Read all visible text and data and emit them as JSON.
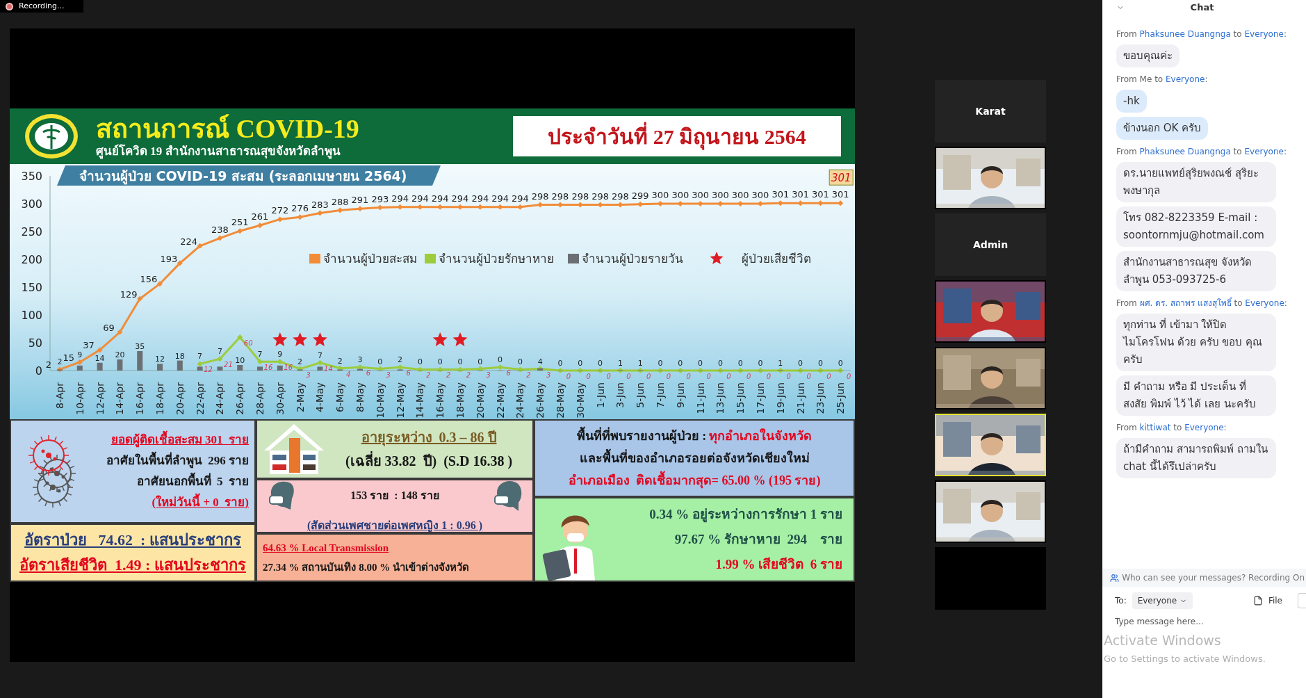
{
  "recording": {
    "label": "Recording..."
  },
  "slide": {
    "header": {
      "title": "สถานการณ์ COVID-19",
      "subtitle": "ศูนย์โควิด 19 สำนักงานสาธารณสุขจังหวัดลำพูน",
      "date": "ประจำวันที่ 27 มิถุนายน 2564"
    },
    "chart": {
      "chart_data": {
        "type": "line",
        "title": "จำนวนผู้ป่วย COVID-19 สะสม (ระลอกเมษายน 2564)",
        "categories": [
          "8-Apr",
          "10-Apr",
          "12-Apr",
          "14-Apr",
          "16-Apr",
          "18-Apr",
          "20-Apr",
          "22-Apr",
          "24-Apr",
          "26-Apr",
          "28-Apr",
          "30-Apr",
          "2-May",
          "4-May",
          "6-May",
          "8-May",
          "10-May",
          "12-May",
          "14-May",
          "16-May",
          "18-May",
          "20-May",
          "22-May",
          "24-May",
          "26-May",
          "28-May",
          "30-May",
          "1-Jun",
          "3-Jun",
          "5-Jun",
          "7-Jun",
          "9-Jun",
          "11-Jun",
          "13-Jun",
          "15-Jun",
          "17-Jun",
          "19-Jun",
          "21-Jun",
          "23-Jun",
          "25-Jun"
        ],
        "series": [
          {
            "name": "จำนวนผู้ป่วยสะสม",
            "color": "#f28c38",
            "marker": "diamond",
            "values": [
              2,
              15,
              37,
              69,
              129,
              156,
              193,
              224,
              238,
              251,
              261,
              272,
              276,
              283,
              288,
              291,
              293,
              294,
              294,
              294,
              294,
              294,
              294,
              294,
              298,
              298,
              298,
              298,
              298,
              299,
              300,
              300,
              300,
              300,
              300,
              300,
              301,
              301,
              301,
              301
            ],
            "value_labels": [
              "2",
              "15",
              "37",
              "69",
              "129",
              "156",
              "193",
              "224",
              "238",
              "251",
              "261",
              "272",
              "276",
              "283",
              "288",
              "291",
              "293",
              "294",
              "294",
              "294",
              "294",
              "294",
              "294",
              "294",
              "298",
              "298",
              "298",
              "298",
              "298",
              "299",
              "300",
              "300",
              "300",
              "300",
              "300",
              "300",
              "301",
              "301",
              "301",
              "301"
            ]
          },
          {
            "name": "จำนวนผู้ป่วยรักษาหาย",
            "color": "#9ccc3c",
            "marker": "diamond",
            "values": [
              null,
              null,
              null,
              null,
              null,
              null,
              null,
              12,
              21,
              60,
              16,
              16,
              3,
              14,
              4,
              6,
              3,
              6,
              2,
              2,
              2,
              3,
              6,
              2,
              3,
              0,
              0,
              0,
              0,
              0,
              0,
              0,
              0,
              0,
              0,
              0,
              0,
              0,
              0,
              0
            ],
            "value_labels": [
              null,
              null,
              null,
              null,
              null,
              null,
              null,
              "12",
              "21",
              "60",
              "16",
              "16",
              "3",
              "14",
              "4",
              "6",
              "3",
              "6",
              "2",
              "2",
              "2",
              "3",
              "6",
              "2",
              "3",
              "0",
              "0",
              "0",
              "0",
              "0",
              "0",
              "0",
              "0",
              "0",
              "0",
              "0",
              "0",
              "0",
              "0",
              "0"
            ]
          },
          {
            "name": "จำนวนผู้ป่วยรายวัน",
            "type": "bar",
            "color": "#6b6f73",
            "values": [
              2,
              9,
              14,
              20,
              35,
              12,
              18,
              7,
              7,
              10,
              7,
              9,
              2,
              7,
              2,
              3,
              0,
              2,
              0,
              0,
              0,
              0,
              0,
              0,
              4,
              0,
              0,
              0,
              1,
              1,
              0,
              0,
              0,
              0,
              0,
              0,
              1,
              0,
              0,
              0
            ],
            "value_labels": [
              "2",
              "9",
              "14",
              "20",
              "35",
              "12",
              "18",
              "7",
              "7",
              "10",
              "7",
              "9",
              "2",
              "7",
              "2",
              "3",
              "0",
              "2",
              "0",
              "0",
              "0",
              "0",
              "0",
              "0",
              "4",
              "0",
              "0",
              "0",
              "1",
              "1",
              "0",
              "0",
              "0",
              "0",
              "0",
              "0",
              "1",
              "0",
              "0",
              "0"
            ]
          },
          {
            "name": "ผู้ป่วยเสียชีวิต",
            "type": "scatter",
            "marker": "star",
            "color": "#e01b24",
            "values": [
              null,
              null,
              null,
              null,
              null,
              null,
              null,
              null,
              null,
              null,
              null,
              55,
              55,
              55,
              null,
              null,
              null,
              null,
              null,
              55,
              55,
              null,
              null,
              null,
              null,
              null,
              null,
              null,
              null,
              null,
              null,
              null,
              null,
              null,
              null,
              null,
              null,
              null,
              null,
              null
            ]
          }
        ],
        "ylim": [
          0,
          350
        ],
        "yticks": [
          0,
          50,
          100,
          150,
          200,
          250,
          300,
          350
        ],
        "legend": "center",
        "annotations": [
          {
            "x": "25-Jun",
            "y": 301,
            "text": "301"
          }
        ]
      }
    },
    "panel_columns": [
      {
        "panels": [
          {
            "kind": "cases",
            "lines": [
              {
                "text": "ยอดผู้ติดเชื้อสะสม 301  ราย",
                "color": "#e3061f",
                "underlined": true
              },
              {
                "text": "อาศัยในพื้นที่ลำพูน  296 ราย",
                "color": "#161616",
                "underlined": false
              },
              {
                "text": "อาศัยนอกพื้นที่  5  ราย",
                "color": "#161616",
                "underlined": false
              },
              {
                "text": "(ใหม่วันนี้ + 0  ราย)",
                "color": "#e3061f",
                "underlined": true
              }
            ]
          },
          {
            "kind": "rates",
            "lines": [
              {
                "text": "อัตราป่วย   74.62  : แสนประชากร",
                "color": "#2b3f7a",
                "underlined": true
              },
              {
                "text": "อัตราเสียชีวิต  1.49 : แสนประชากร",
                "color": "#e3061f",
                "underlined": true
              }
            ]
          }
        ]
      },
      {
        "panels": [
          {
            "kind": "age",
            "lines": [
              {
                "text": "อายุระหว่าง  0.3 – 86 ปี",
                "color": "#7b5b22",
                "underlined": true
              },
              {
                "text": "(เฉลี่ย 33.82  ปี)  (S.D 16.38 )",
                "color": "#161616",
                "underlined": false
              }
            ]
          },
          {
            "kind": "gender",
            "lines": [
              {
                "text": "153 ราย  : 148 ราย",
                "color": "#161616",
                "underlined": false
              },
              {
                "text": "(สัดส่วนเพศชายต่อเพศหญิง 1 : 0.96 )",
                "color": "#2b3f7a",
                "underlined": true
              }
            ]
          },
          {
            "kind": "source",
            "lines": [
              {
                "text": "64.63 % Local Transmission",
                "color": "#e3061f",
                "underlined": true
              },
              {
                "text": "27.34 % สถานบันเทิง",
                "color": "#161616",
                "underlined": false,
                "second": {
                  "text": "8.00 % นำเข้าต่างจังหวัด",
                  "color": "#161616"
                }
              }
            ]
          }
        ]
      },
      {
        "panels": [
          {
            "kind": "area",
            "lines": [
              {
                "text": "พื้นที่ที่พบรายงานผู้ป่วย :",
                "color": "#161616",
                "underlined": false,
                "second": {
                  "text": "ทุกอำเภอในจังหวัด",
                  "color": "#e3061f"
                }
              },
              {
                "text": "และพื้นที่ของอำเภอรอยต่อจังหวัดเชียงใหม่",
                "color": "#161616",
                "underlined": false
              },
              {
                "text": "อำเภอเมือง  ติดเชื้อมากสุด= 65.00 % (195 ราย)",
                "color": "#e3061f",
                "underlined": false
              }
            ]
          },
          {
            "kind": "outcome",
            "lines": [
              {
                "text": "0.34 % อยู่ระหว่างการรักษา 1 ราย",
                "color": "#1f4f46",
                "underlined": false
              },
              {
                "text": "97.67 % รักษาหาย  294    ราย",
                "color": "#1f4f46",
                "underlined": false
              },
              {
                "text": "1.99 % เสียชีวิต  6 ราย",
                "color": "#e3061f",
                "underlined": false
              }
            ]
          }
        ]
      }
    ]
  },
  "video_tiles": [
    {
      "kind": "name",
      "label": "Karat",
      "selected": false
    },
    {
      "kind": "picture",
      "selected": false
    },
    {
      "kind": "name",
      "label": "Admin",
      "selected": false
    },
    {
      "kind": "picture",
      "selected": false
    },
    {
      "kind": "picture",
      "selected": false
    },
    {
      "kind": "picture",
      "selected": true
    },
    {
      "kind": "picture",
      "selected": false
    },
    {
      "kind": "empty",
      "selected": false
    }
  ],
  "chat": {
    "title": "Chat",
    "groups": [
      {
        "from_word": "From",
        "sender": "Phaksunee Duangnga",
        "to_word": "to",
        "recipient": "Everyone",
        "end": ":",
        "self": false,
        "messages": [
          "ขอบคุณค่ะ"
        ]
      },
      {
        "from_word": "From",
        "sender": "Me",
        "to_word": "to",
        "recipient": "Everyone",
        "end": ":",
        "self": true,
        "messages": [
          "-hk",
          "ข้างนอก OK ครับ"
        ]
      },
      {
        "from_word": "From",
        "sender": "Phaksunee Duangnga",
        "to_word": "to",
        "recipient": "Everyone",
        "end": ":",
        "self": false,
        "messages": [
          "ดร.นายแพทย์สุริยพงณช์ สุริยะพงษากุล",
          "โทร 082-8223359  E-mail : soontornmju@hotmail.com",
          "สำนักงานสาธารณสุข จังหวัดลำพูน 053-093725-6"
        ]
      },
      {
        "from_word": "From",
        "sender": "ผศ. ดร. สถาพร แสงสุโพธิ์",
        "to_word": "to",
        "recipient": "Everyone",
        "end": ":",
        "self": false,
        "messages": [
          "ทุกท่าน ที่ เข้ามา ให้ปิด ไมโครโฟน ด้วย ครับ ขอบ คุณ ครับ",
          "มี คำถาม หรือ มี ประเด็น ที่ สงสัย พิมพ์ ไว้ ได้ เลย นะครับ"
        ]
      },
      {
        "from_word": "From",
        "sender": "kittiwat",
        "to_word": "to",
        "recipient": "Everyone",
        "end": ":",
        "self": false,
        "messages": [
          "ถ้ามีคำถาม สามารถพิมพ์ ถามใน chat นี้ได้รึเปล่าครับ"
        ]
      }
    ],
    "notice": "Who can see your messages? Recording On",
    "to_label": "To:",
    "recipient_button": "Everyone",
    "file_button": "File",
    "placeholder": "Type message here..."
  },
  "activation": {
    "title": "Activate Windows",
    "detail": "Go to Settings to activate Windows."
  }
}
